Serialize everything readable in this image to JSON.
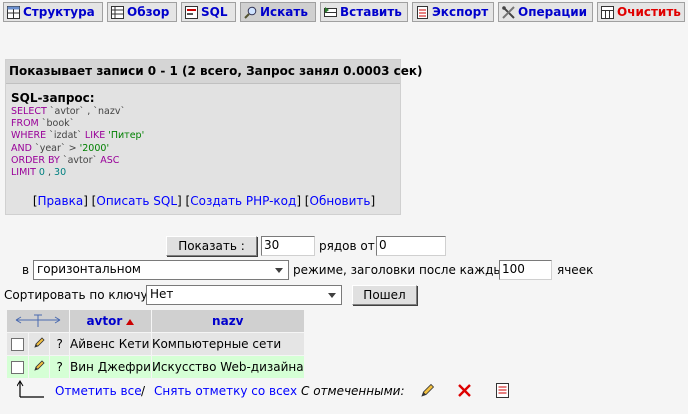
{
  "tabs": [
    {
      "label": "Структура",
      "icon": "table-structure-icon"
    },
    {
      "label": "Обзор",
      "icon": "browse-table-icon"
    },
    {
      "label": "SQL",
      "icon": "sql-icon"
    },
    {
      "label": "Искать",
      "icon": "search-magnifier-icon"
    },
    {
      "label": "Вставить",
      "icon": "insert-row-icon"
    },
    {
      "label": "Экспорт",
      "icon": "export-icon"
    },
    {
      "label": "Операции",
      "icon": "operations-tools-icon"
    },
    {
      "label": "Очистить",
      "icon": "empty-table-icon"
    }
  ],
  "message": {
    "header": "Показывает записи 0 - 1 (2 всего, Запрос занял 0.0003 сек)",
    "sql_title": "SQL-запрос:",
    "sql_lines": [
      [
        "SELECT ",
        "`avtor`",
        " , ",
        "`nazv`"
      ],
      [
        "FROM ",
        "`book`"
      ],
      [
        "WHERE ",
        "`izdat`",
        " LIKE ",
        "'Питер'"
      ],
      [
        "AND ",
        "`year`",
        " > ",
        "'2000'"
      ],
      [
        "ORDER BY ",
        "`avtor`",
        " ASC"
      ],
      [
        "LIMIT ",
        "0",
        " , ",
        "30"
      ]
    ],
    "links": {
      "edit": "Правка",
      "explain": "Описать SQL",
      "php": "Создать PHP-код",
      "refresh": "Обновить"
    }
  },
  "nav": {
    "show_button": "Показать :",
    "rows_value": "30",
    "rows_from_label": "рядов от",
    "from_value": "0",
    "in_label": "в",
    "mode_value": "горизонтальном",
    "mode_label": "режиме, заголовки после каждых",
    "repeat_value": "100",
    "cells_label": "ячеек",
    "sort_label": "Сортировать по ключу:",
    "sort_value": "Нет",
    "go_button": "Пошел"
  },
  "table": {
    "columns": [
      "avtor",
      "nazv"
    ],
    "rows": [
      {
        "avtor": "Айвенс Кети",
        "nazv": "Компьютерные сети"
      },
      {
        "avtor": "Вин Джефри",
        "nazv": "Искусство Web-дизайна"
      }
    ],
    "row_marker": "?"
  },
  "bottom": {
    "check_all": "Отметить все",
    "separator": "/",
    "uncheck_all": "Снять отметку со всех",
    "with_selected": "С отмеченными:"
  },
  "colors": {
    "tab_label": "#0000cc",
    "clear_label": "#e00000",
    "link": "#0000ff",
    "row_even": "#e5e5e5",
    "row_odd": "#d5ffd5"
  }
}
